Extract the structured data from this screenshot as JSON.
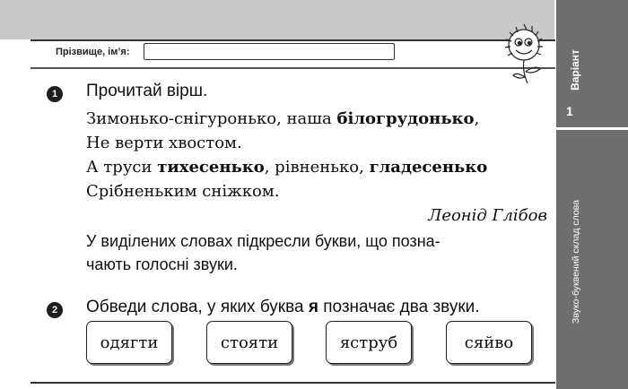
{
  "header": {
    "name_label": "Прізвище, ім’я:",
    "name_value": ""
  },
  "sidebar": {
    "variant_label": "Варіант",
    "variant_number": "1",
    "topic": "Звуко-буквений склад слова"
  },
  "task1": {
    "number": "1",
    "title": "Прочитай вірш.",
    "poem": [
      {
        "parts": [
          {
            "text": "Зимонько-снігуронько, наша ",
            "bold": false
          },
          {
            "text": "білогрудонько",
            "bold": true
          },
          {
            "text": ",",
            "bold": false
          }
        ]
      },
      {
        "parts": [
          {
            "text": "Не верти хвостом.",
            "bold": false
          }
        ]
      },
      {
        "parts": [
          {
            "text": "А труси ",
            "bold": false
          },
          {
            "text": "тихесенько",
            "bold": true
          },
          {
            "text": ", рівненько, ",
            "bold": false
          },
          {
            "text": "гладесенько",
            "bold": true
          }
        ]
      },
      {
        "parts": [
          {
            "text": "Срібненьким сніжком.",
            "bold": false
          }
        ]
      }
    ],
    "author": "Леонід Глібов",
    "instruction_line1": "У виділених словах підкресли букви, що позна-",
    "instruction_line2": "чають голосні звуки."
  },
  "task2": {
    "number": "2",
    "title_before": "Обведи слова, у яких буква ",
    "title_bold": "я",
    "title_after": " позначає два звуки.",
    "words": [
      "одягти",
      "стояти",
      "яструб",
      "сяйво"
    ]
  },
  "colors": {
    "sidebar": "#6e6e6e",
    "top_band": "#c9c9c9",
    "task_badge": "#1e1e1e"
  },
  "icons": {
    "mascot": "sunflower-mascot-icon"
  }
}
